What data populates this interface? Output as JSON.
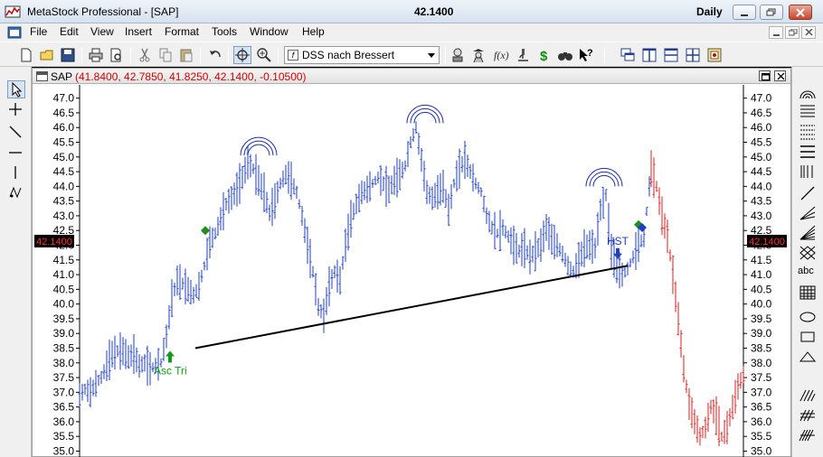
{
  "window": {
    "title": "MetaStock Professional - [SAP]",
    "price": "42.1400",
    "period": "Daily"
  },
  "menu": {
    "items": [
      "File",
      "Edit",
      "View",
      "Insert",
      "Format",
      "Tools",
      "Window",
      "Help"
    ]
  },
  "toolbar": {
    "expert_select": "DSS nach Bressert",
    "expert_icon_glyph": "f",
    "dollar_glyph": "$",
    "help_glyph": "?"
  },
  "righttools": {
    "text_tool": "abc"
  },
  "chart_window": {
    "symbol": "SAP",
    "ohlc": "(41.8400, 42.7850, 41.8250, 42.1400, -0.10500)"
  },
  "chart_data": {
    "type": "bar",
    "ylim": [
      34.8,
      47.45
    ],
    "yticks": [
      "47.0",
      "46.5",
      "46.0",
      "45.5",
      "45.0",
      "44.5",
      "44.0",
      "43.5",
      "43.0",
      "42.5",
      "42.0",
      "41.5",
      "41.0",
      "40.5",
      "40.0",
      "39.5",
      "39.0",
      "38.5",
      "38.0",
      "37.5",
      "37.0",
      "36.5",
      "36.0",
      "35.5",
      "35.0"
    ],
    "last_price_label": "42.1400",
    "last_price": 42.14,
    "colors": {
      "blue_bars": "#1f3fbf",
      "red_bars": "#d42020",
      "label_bg": "#000000",
      "label_fg": "#ff3030",
      "arc": "#1c2fa8",
      "green_arrow": "#169a16",
      "diamond_green": "#1f8f1f",
      "diamond_blue": "#1f3fbf"
    },
    "annotations": {
      "pattern_tri": "Asc Tri",
      "pattern_hst": "HST"
    },
    "neckline": {
      "from_price": 38.5,
      "to_price": 41.3
    },
    "price_path_blue": [
      [
        0,
        36.9
      ],
      [
        6,
        37.1
      ],
      [
        12,
        37.0
      ],
      [
        18,
        37.3
      ],
      [
        24,
        37.5
      ],
      [
        30,
        37.9
      ],
      [
        36,
        38.3
      ],
      [
        42,
        38.4
      ],
      [
        48,
        38.4
      ],
      [
        54,
        38.2
      ],
      [
        60,
        38.3
      ],
      [
        66,
        37.9
      ],
      [
        72,
        38.0
      ],
      [
        78,
        37.8
      ],
      [
        84,
        37.9
      ],
      [
        90,
        38.0
      ],
      [
        96,
        38.9
      ],
      [
        102,
        40.2
      ],
      [
        108,
        40.8
      ],
      [
        114,
        40.7
      ],
      [
        120,
        40.5
      ],
      [
        126,
        40.3
      ],
      [
        132,
        40.6
      ],
      [
        138,
        41.3
      ],
      [
        144,
        42.1
      ],
      [
        150,
        42.4
      ],
      [
        156,
        42.9
      ],
      [
        162,
        43.4
      ],
      [
        168,
        43.6
      ],
      [
        174,
        43.9
      ],
      [
        180,
        44.3
      ],
      [
        186,
        44.8
      ],
      [
        192,
        44.6
      ],
      [
        198,
        44.2
      ],
      [
        204,
        43.8
      ],
      [
        210,
        43.1
      ],
      [
        216,
        43.5
      ],
      [
        222,
        44.1
      ],
      [
        228,
        44.4
      ],
      [
        234,
        44.2
      ],
      [
        240,
        43.8
      ],
      [
        246,
        43.0
      ],
      [
        252,
        42.0
      ],
      [
        258,
        41.1
      ],
      [
        264,
        39.9
      ],
      [
        270,
        39.6
      ],
      [
        276,
        40.6
      ],
      [
        282,
        41.1
      ],
      [
        288,
        40.8
      ],
      [
        294,
        42.0
      ],
      [
        300,
        42.9
      ],
      [
        306,
        43.4
      ],
      [
        312,
        43.8
      ],
      [
        318,
        43.9
      ],
      [
        324,
        44.1
      ],
      [
        330,
        44.3
      ],
      [
        336,
        44.1
      ],
      [
        342,
        43.9
      ],
      [
        348,
        44.2
      ],
      [
        354,
        44.4
      ],
      [
        360,
        44.7
      ],
      [
        366,
        45.5
      ],
      [
        372,
        46.0
      ],
      [
        378,
        44.9
      ],
      [
        384,
        43.8
      ],
      [
        390,
        43.6
      ],
      [
        396,
        43.8
      ],
      [
        402,
        44.0
      ],
      [
        408,
        43.2
      ],
      [
        414,
        44.1
      ],
      [
        420,
        44.6
      ],
      [
        426,
        44.9
      ],
      [
        432,
        44.5
      ],
      [
        438,
        44.1
      ],
      [
        444,
        43.8
      ],
      [
        450,
        43.0
      ],
      [
        456,
        42.6
      ],
      [
        462,
        42.4
      ],
      [
        468,
        42.6
      ],
      [
        474,
        42.3
      ],
      [
        480,
        42.0
      ],
      [
        486,
        41.8
      ],
      [
        492,
        41.9
      ],
      [
        498,
        41.6
      ],
      [
        504,
        41.8
      ],
      [
        510,
        42.0
      ],
      [
        516,
        42.6
      ],
      [
        522,
        42.2
      ],
      [
        528,
        42.0
      ],
      [
        534,
        41.7
      ],
      [
        540,
        41.3
      ],
      [
        546,
        41.1
      ],
      [
        552,
        41.5
      ],
      [
        558,
        41.9
      ],
      [
        564,
        42.0
      ],
      [
        570,
        41.9
      ],
      [
        576,
        43.2
      ],
      [
        582,
        43.7
      ],
      [
        588,
        41.8
      ],
      [
        594,
        41.3
      ],
      [
        600,
        41.0
      ],
      [
        606,
        41.2
      ],
      [
        612,
        41.6
      ],
      [
        618,
        42.0
      ],
      [
        624,
        42.3
      ],
      [
        630,
        44.0
      ]
    ],
    "price_path_red": [
      [
        632,
        44.6
      ],
      [
        638,
        44.0
      ],
      [
        644,
        43.0
      ],
      [
        650,
        42.3
      ],
      [
        656,
        41.0
      ],
      [
        662,
        39.5
      ],
      [
        668,
        37.8
      ],
      [
        674,
        36.6
      ],
      [
        680,
        36.0
      ],
      [
        686,
        35.5
      ],
      [
        692,
        35.8
      ],
      [
        698,
        36.5
      ],
      [
        704,
        36.2
      ],
      [
        710,
        35.5
      ],
      [
        716,
        35.8
      ],
      [
        722,
        36.5
      ],
      [
        728,
        37.2
      ],
      [
        734,
        37.6
      ]
    ]
  }
}
